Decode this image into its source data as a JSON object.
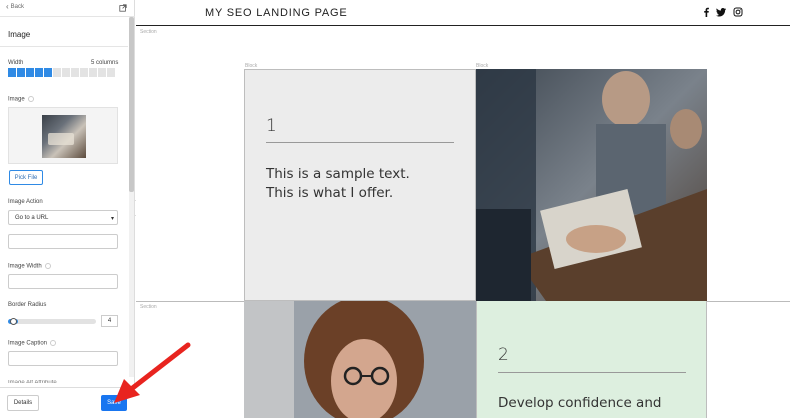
{
  "sidebar": {
    "back_label": "Back",
    "title": "Image",
    "width_label": "Width",
    "width_value": "5 columns",
    "width_columns_total": 12,
    "width_columns_on": 5,
    "image_label": "Image",
    "pick_file_label": "Pick File",
    "image_action_label": "Image Action",
    "image_action_selected": "Go to a URL",
    "image_width_label": "Image Width",
    "border_radius_label": "Border Radius",
    "border_radius_value": "4",
    "image_caption_label": "Image Caption",
    "cut_label": "Image Alt Attribute",
    "details_label": "Details",
    "save_label": "Save"
  },
  "site": {
    "title": "MY SEO LANDING PAGE",
    "social_icons": [
      "facebook-icon",
      "twitter-icon",
      "instagram-icon"
    ],
    "section_label": "Section",
    "block_label": "Block",
    "block1_number": "1",
    "block1_text_line1": "This is a sample text.",
    "block1_text_line2": "This is what I offer.",
    "block2_number": "2",
    "block2_text_line1": "Develop confidence and"
  },
  "colors": {
    "accent": "#1976f0",
    "slider": "#2f8ae5",
    "green_block": "#ddefdf",
    "gray_block": "#ececec",
    "arrow": "#e8241f"
  }
}
